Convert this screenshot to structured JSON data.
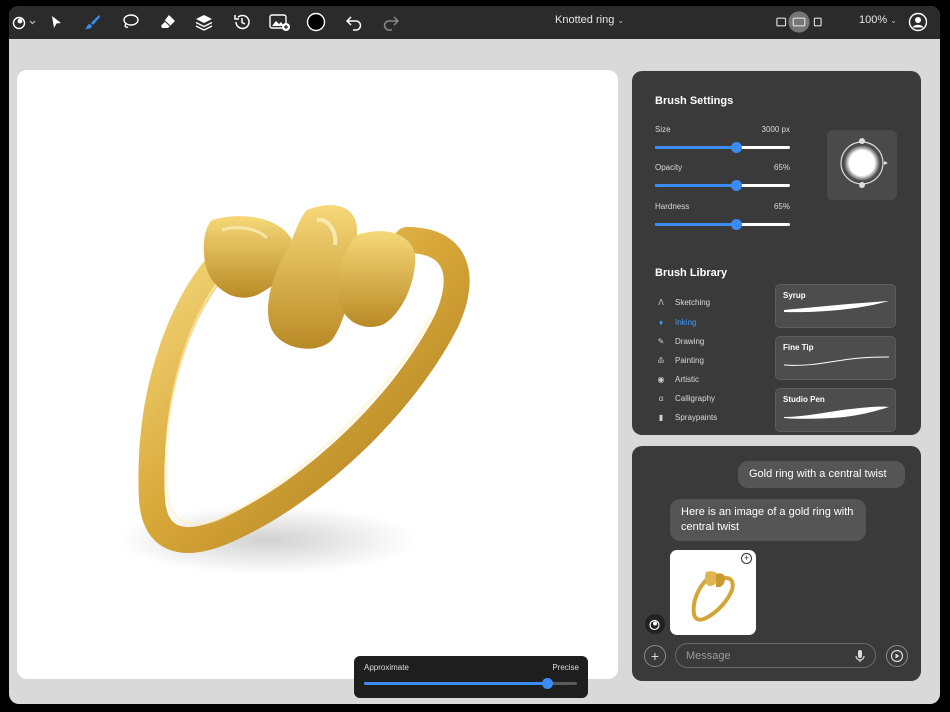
{
  "toolbar": {
    "document_title": "Knotted ring",
    "zoom": "100%",
    "icons": [
      "app-logo-icon",
      "select-arrow-icon",
      "brush-icon",
      "lasso-icon",
      "eraser-icon",
      "layers-icon",
      "history-icon",
      "add-image-icon",
      "color-swatch-icon",
      "undo-icon",
      "redo-icon",
      "view-layout-icon",
      "account-icon"
    ],
    "active_tool": "brush-icon",
    "color_swatch": "#000000"
  },
  "precision_slider": {
    "left_label": "Approximate",
    "right_label": "Precise",
    "value_fraction": 0.86
  },
  "brush_settings": {
    "title": "Brush Settings",
    "sliders": [
      {
        "name": "Size",
        "value": "3000 px",
        "fraction": 0.6
      },
      {
        "name": "Opacity",
        "value": "65%",
        "fraction": 0.6
      },
      {
        "name": "Hardness",
        "value": "65%",
        "fraction": 0.6
      }
    ]
  },
  "brush_library": {
    "title": "Brush Library",
    "categories": [
      {
        "label": "Sketching",
        "icon": "pencil-icon",
        "active": false
      },
      {
        "label": "Inking",
        "icon": "ink-drop-icon",
        "active": true
      },
      {
        "label": "Drawing",
        "icon": "drawing-icon",
        "active": false
      },
      {
        "label": "Painting",
        "icon": "paintbrush-icon",
        "active": false
      },
      {
        "label": "Artistic",
        "icon": "palette-icon",
        "active": false
      },
      {
        "label": "Calligraphy",
        "icon": "calligraphy-icon",
        "active": false
      },
      {
        "label": "Spraypaints",
        "icon": "spray-can-icon",
        "active": false
      }
    ],
    "strokes": [
      {
        "name": "Syrup"
      },
      {
        "name": "Fine Tip"
      },
      {
        "name": "Studio Pen"
      }
    ]
  },
  "chat": {
    "messages": [
      {
        "role": "user",
        "text": "Gold ring with a central twist"
      },
      {
        "role": "assistant",
        "text": "Here is an image of a gold ring with central twist"
      }
    ],
    "input_placeholder": "Message"
  },
  "colors": {
    "accent": "#3b8cf2",
    "panel": "#3a3a3a",
    "toolbar": "#2b2b2b",
    "gold": "#d4a63a"
  }
}
